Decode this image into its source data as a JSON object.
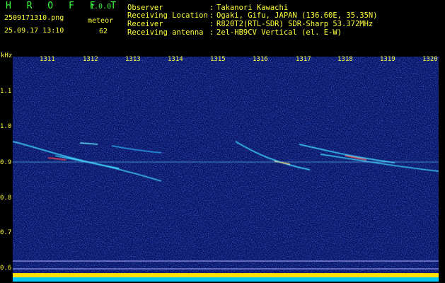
{
  "header": {
    "app_name": "H R O F F T",
    "version": "1.0.0",
    "filename": "2509171310.png",
    "timestamp": "25.09.17 13:10",
    "detection_label": "meteor",
    "detection_count": "62"
  },
  "station": {
    "rows": [
      {
        "label": "Observer",
        "value": "Takanori Kawachi"
      },
      {
        "label": "Receiving Location",
        "value": "Ogaki, Gifu, JAPAN (136.60E, 35.35N)"
      },
      {
        "label": "Receiver",
        "value": "R820T2(RTL-SDR) SDR-Sharp 53.372MHz"
      },
      {
        "label": "Receiving antenna",
        "value": "2el-HB9CV Vertical (el. E-W)"
      }
    ],
    "separator": ":"
  },
  "spectrogram": {
    "freq_unit": "kHz",
    "freq_ticks": [
      "1.1",
      "1.0",
      "0.9",
      "0.8",
      "0.7",
      "0.6"
    ],
    "time_ticks": [
      "1311",
      "1312",
      "1313",
      "1314",
      "1315",
      "1316",
      "1317",
      "1318",
      "1319",
      "1320"
    ]
  },
  "colors": {
    "background": "#000000",
    "header_green": "#3dff3d",
    "header_yellow": "#ffff3c",
    "noise_floor": "#0a1a8c",
    "level_bar": "#ffe000",
    "level_base": "#00c8ff"
  }
}
